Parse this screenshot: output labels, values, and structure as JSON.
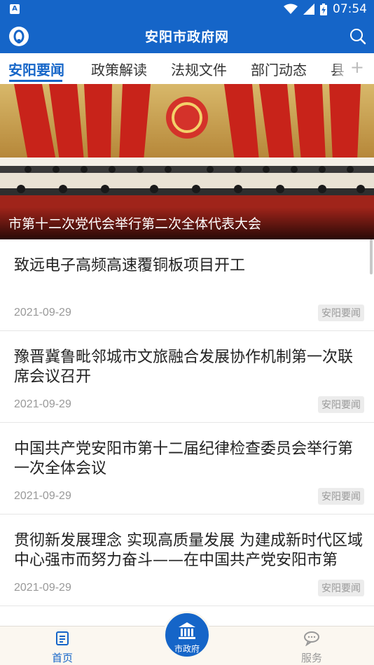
{
  "status_bar": {
    "time": "07:54",
    "app_icon": "A"
  },
  "header": {
    "title": "安阳市政府网"
  },
  "tabs": [
    {
      "label": "安阳要闻",
      "active": true
    },
    {
      "label": "政策解读",
      "active": false
    },
    {
      "label": "法规文件",
      "active": false
    },
    {
      "label": "部门动态",
      "active": false
    },
    {
      "label": "县",
      "active": false
    }
  ],
  "banner": {
    "caption": "市第十二次党代会举行第二次全体代表大会"
  },
  "news": [
    {
      "title": "致远电子高频高速覆铜板项目开工",
      "date": "2021-09-29",
      "tag": "安阳要闻"
    },
    {
      "title": "豫晋冀鲁毗邻城市文旅融合发展协作机制第一次联席会议召开",
      "date": "2021-09-29",
      "tag": "安阳要闻"
    },
    {
      "title": "中国共产党安阳市第十二届纪律检查委员会举行第一次全体会议",
      "date": "2021-09-29",
      "tag": "安阳要闻"
    },
    {
      "title": "贯彻新发展理念 实现高质量发展 为建成新时代区域中心强市而努力奋斗——在中国共产党安阳市第",
      "date": "2021-09-29",
      "tag": "安阳要闻"
    }
  ],
  "bottom_nav": {
    "home": "首页",
    "center": "市政府",
    "service": "服务"
  },
  "colors": {
    "primary": "#1565c8",
    "banner_red": "#c0231a"
  }
}
